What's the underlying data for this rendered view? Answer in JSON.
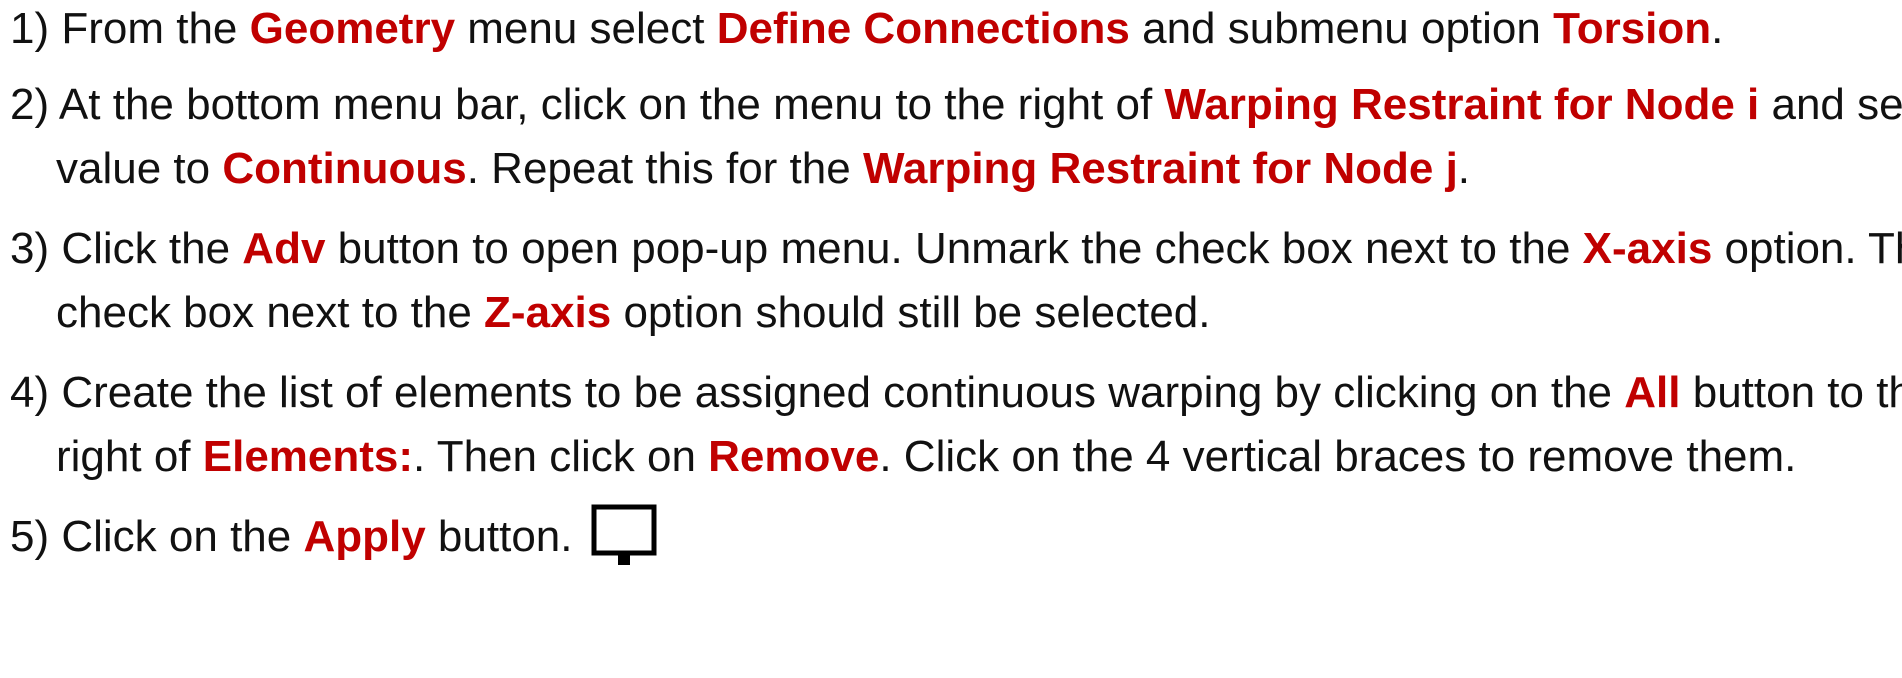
{
  "steps": [
    {
      "number": "1)",
      "line1": [
        {
          "t": " From the ",
          "h": false
        },
        {
          "t": "Geometry",
          "h": true
        },
        {
          "t": " menu select ",
          "h": false
        },
        {
          "t": "Define Connections",
          "h": true
        },
        {
          "t": " and submenu option ",
          "h": false
        },
        {
          "t": "Torsion",
          "h": true
        },
        {
          "t": ".",
          "h": false
        }
      ]
    },
    {
      "number": "2)",
      "line1": [
        {
          "t": " At the bottom menu bar, click on the menu to the right of ",
          "h": false
        },
        {
          "t": "Warping Restraint for Node i",
          "h": true
        },
        {
          "t": " and set the",
          "h": false
        }
      ],
      "line2": [
        {
          "t": "value to ",
          "h": false
        },
        {
          "t": "Continuous",
          "h": true
        },
        {
          "t": ". Repeat this for the ",
          "h": false
        },
        {
          "t": "Warping Restraint for Node j",
          "h": true
        },
        {
          "t": ".",
          "h": false
        }
      ]
    },
    {
      "number": "3)",
      "line1": [
        {
          "t": " Click the ",
          "h": false
        },
        {
          "t": "Adv",
          "h": true
        },
        {
          "t": " button to open pop-up menu. Unmark the check box next to the ",
          "h": false
        },
        {
          "t": "X-axis",
          "h": true
        },
        {
          "t": " option. The",
          "h": false
        }
      ],
      "line2": [
        {
          "t": "check box next to the ",
          "h": false
        },
        {
          "t": "Z-axis",
          "h": true
        },
        {
          "t": " option should still be selected.",
          "h": false
        }
      ]
    },
    {
      "number": "4)",
      "line1": [
        {
          "t": " Create the list of elements to be assigned continuous warping by clicking on the ",
          "h": false
        },
        {
          "t": "All",
          "h": true
        },
        {
          "t": " button to the",
          "h": false
        }
      ],
      "line2": [
        {
          "t": "right of ",
          "h": false
        },
        {
          "t": "Elements:",
          "h": true
        },
        {
          "t": ". Then click on ",
          "h": false
        },
        {
          "t": "Remove",
          "h": true
        },
        {
          "t": ". Click on the 4 vertical braces to remove them.",
          "h": false
        }
      ]
    },
    {
      "number": "5)",
      "line1": [
        {
          "t": " Click on the ",
          "h": false
        },
        {
          "t": "Apply",
          "h": true
        },
        {
          "t": " button.",
          "h": false
        }
      ],
      "icon": "monitor-apply-icon"
    }
  ],
  "colors": {
    "highlight": "#c00000",
    "text": "#111111"
  }
}
